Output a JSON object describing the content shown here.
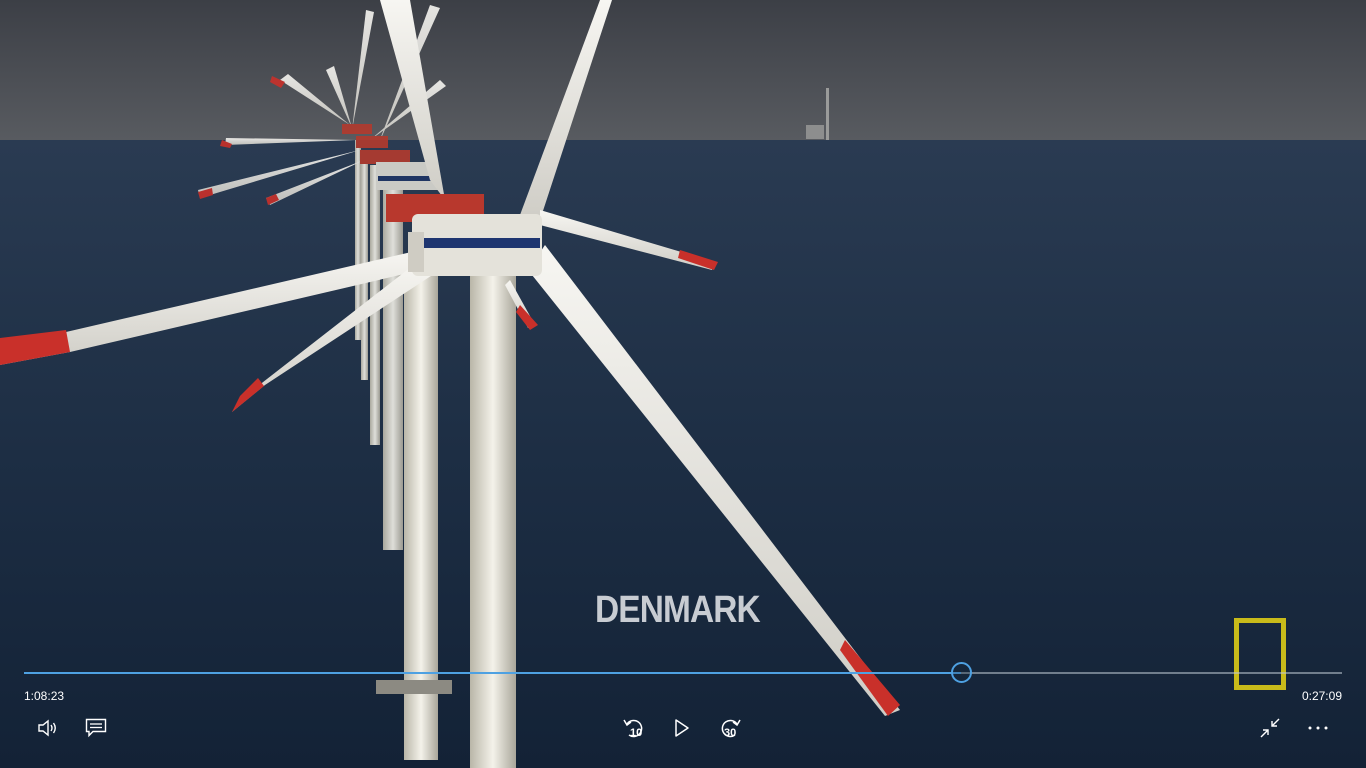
{
  "video": {
    "caption": "DENMARK",
    "logo": "national-geographic-logo"
  },
  "player": {
    "elapsed": "1:08:23",
    "remaining": "0:27:09",
    "progress": 0.7113,
    "accent_color": "#4ea1e2",
    "skip_back_label": "10",
    "skip_forward_label": "30"
  },
  "icons": {
    "volume": "volume-icon",
    "captions": "captions-icon",
    "skip_back": "skip-back-10-icon",
    "play": "play-icon",
    "skip_forward": "skip-forward-30-icon",
    "exit_fullscreen": "exit-fullscreen-icon",
    "more": "more-options-icon"
  }
}
